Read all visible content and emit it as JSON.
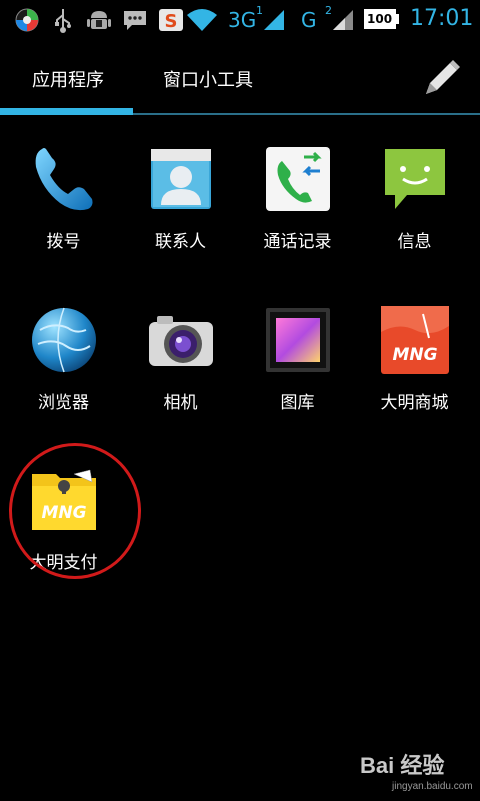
{
  "status_bar": {
    "icons": [
      "app-notification-icon",
      "usb-icon",
      "android-debug-icon",
      "message-icon",
      "sogou-input-icon",
      "wifi-icon"
    ],
    "network1": "3G",
    "network1_sim": "1",
    "network2": "G",
    "network2_sim": "2",
    "battery": "100",
    "time": "17:01"
  },
  "tabs": [
    {
      "label": "应用程序",
      "active": true
    },
    {
      "label": "窗口小工具",
      "active": false
    }
  ],
  "colors": {
    "accent": "#33b5e5",
    "highlight_circle": "#d11a1a"
  },
  "apps": [
    {
      "label": "拨号",
      "icon": "phone-icon"
    },
    {
      "label": "联系人",
      "icon": "contacts-icon"
    },
    {
      "label": "通话记录",
      "icon": "call-log-icon"
    },
    {
      "label": "信息",
      "icon": "messaging-icon"
    },
    {
      "label": "浏览器",
      "icon": "browser-globe-icon"
    },
    {
      "label": "相机",
      "icon": "camera-icon"
    },
    {
      "label": "图库",
      "icon": "gallery-icon"
    },
    {
      "label": "大明商城",
      "icon": "daming-mall-icon"
    },
    {
      "label": "大明支付",
      "icon": "daming-pay-icon"
    }
  ],
  "watermark": {
    "logo": "Bai 经验",
    "url": "jingyan.baidu.com"
  }
}
